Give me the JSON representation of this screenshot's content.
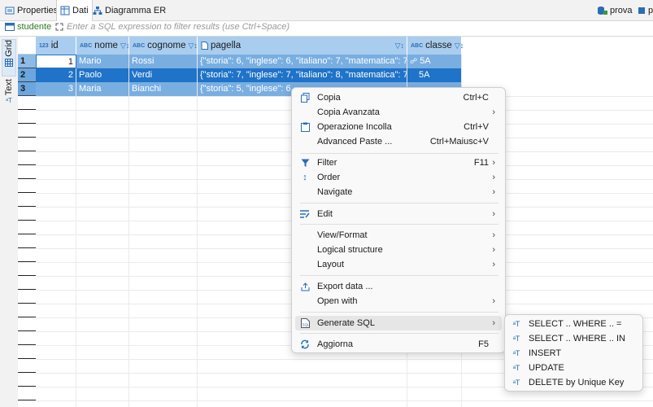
{
  "tabs": [
    {
      "label": "Properties"
    },
    {
      "label": "Dati"
    },
    {
      "label": "Diagramma ER"
    }
  ],
  "right_items": [
    {
      "label": "prova"
    },
    {
      "label": "p"
    }
  ],
  "filter": {
    "entity": "studente",
    "placeholder": "Enter a SQL expression to filter results (use Ctrl+Space)"
  },
  "side_tabs": {
    "grid": "Grid",
    "text": "Text"
  },
  "columns": [
    {
      "name": "id",
      "type_icon": "123"
    },
    {
      "name": "nome",
      "type_icon": "ABC"
    },
    {
      "name": "cognome",
      "type_icon": "ABC"
    },
    {
      "name": "pagella",
      "type_icon": "json"
    },
    {
      "name": "classe",
      "type_icon": "ABC"
    }
  ],
  "rows": [
    {
      "num": "1",
      "id": "1",
      "nome": "Mario",
      "cognome": "Rossi",
      "pagella": "{\"storia\": 6, \"inglese\": 6, \"italiano\": 7, \"matematica\": 7}",
      "classe": "5A"
    },
    {
      "num": "2",
      "id": "2",
      "nome": "Paolo",
      "cognome": "Verdi",
      "pagella": "{\"storia\": 7, \"inglese\": 7, \"italiano\": 8, \"matematica\": 7}",
      "classe": "5A"
    },
    {
      "num": "3",
      "id": "3",
      "nome": "Maria",
      "cognome": "Bianchi",
      "pagella": "{\"storia\": 5, \"inglese\": 6,",
      "classe": ""
    }
  ],
  "context_menu": {
    "items": [
      {
        "label": "Copia",
        "shortcut": "Ctrl+C",
        "icon": "copy-icon"
      },
      {
        "label": "Copia Avanzata",
        "shortcut": "",
        "icon": "",
        "submenu": true
      },
      {
        "label": "Operazione Incolla",
        "shortcut": "Ctrl+V",
        "icon": "paste-icon"
      },
      {
        "label": "Advanced Paste ...",
        "shortcut": "Ctrl+Maiusc+V",
        "icon": ""
      },
      {
        "label": "Filter",
        "shortcut": "F11",
        "icon": "filter-icon",
        "submenu": true
      },
      {
        "label": "Order",
        "shortcut": "",
        "icon": "sort-icon",
        "submenu": true
      },
      {
        "label": "Navigate",
        "shortcut": "",
        "icon": "",
        "submenu": true
      },
      {
        "label": "Edit",
        "shortcut": "",
        "icon": "edit-icon",
        "submenu": true
      },
      {
        "label": "View/Format",
        "shortcut": "",
        "icon": "",
        "submenu": true
      },
      {
        "label": "Logical structure",
        "shortcut": "",
        "icon": "",
        "submenu": true
      },
      {
        "label": "Layout",
        "shortcut": "",
        "icon": "",
        "submenu": true
      },
      {
        "label": "Export data ...",
        "shortcut": "",
        "icon": "export-icon"
      },
      {
        "label": "Open with",
        "shortcut": "",
        "icon": "",
        "submenu": true
      },
      {
        "label": "Generate SQL",
        "shortcut": "",
        "icon": "sql-icon",
        "submenu": true
      },
      {
        "label": "Aggiorna",
        "shortcut": "F5",
        "icon": "refresh-icon"
      }
    ]
  },
  "generate_sql_submenu": [
    {
      "label": "SELECT .. WHERE .. ="
    },
    {
      "label": "SELECT .. WHERE .. IN"
    },
    {
      "label": "INSERT"
    },
    {
      "label": "UPDATE"
    },
    {
      "label": "DELETE by Unique Key"
    }
  ]
}
